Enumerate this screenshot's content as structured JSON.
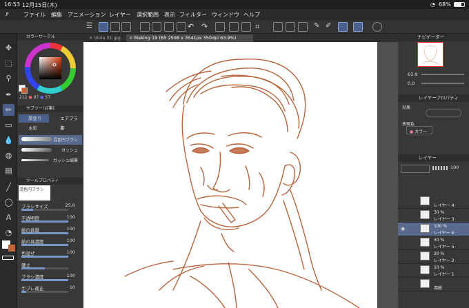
{
  "status": {
    "time": "16:53",
    "date": "12月15日(木)",
    "battery": "68%"
  },
  "menu": [
    "ファイル",
    "編集",
    "アニメーション",
    "レイヤー",
    "選択範囲",
    "表示",
    "フィルター",
    "ウィンドウ",
    "ヘルプ"
  ],
  "tabs": [
    "Viola 01.jpg",
    "Making 19 (B5 2508 x 3541px 350dpi 63.9%)"
  ],
  "color_circle": {
    "title": "カラーサークル",
    "h": "212",
    "s": "97",
    "v": "57",
    "main_color": "#c8643c"
  },
  "subtool": {
    "title": "サブツール[筆]",
    "groups": [
      "厚塗り",
      "エアブラシ",
      "水彩",
      "墨"
    ],
    "brushes": [
      "混色円ブラシ",
      "ガッシュ",
      "ガッシュ細筆"
    ]
  },
  "tool_property": {
    "title": "ツールプロパティ",
    "brush_name": "混色円ブラシ",
    "rows": [
      {
        "label": "ブラシサイズ",
        "value": "25.0",
        "fill": 0.25
      },
      {
        "label": "不透明度",
        "value": "100",
        "fill": 1.0
      },
      {
        "label": "絵の具量",
        "value": "100",
        "fill": 1.0
      },
      {
        "label": "絵の具濃度",
        "value": "100",
        "fill": 1.0
      },
      {
        "label": "色混ぜ",
        "value": "100",
        "fill": 1.0
      },
      {
        "label": "硬さ",
        "value": "",
        "fill": 0.5
      },
      {
        "label": "ブラシ濃度",
        "value": "100",
        "fill": 1.0
      },
      {
        "label": "手ブレ補正",
        "value": "10",
        "fill": 0.1
      }
    ]
  },
  "navigator": {
    "title": "ナビゲーター",
    "zoom": "63.9",
    "rotation": "0.0"
  },
  "layer_property": {
    "title": "レイヤープロパティ",
    "effect_label": "効果",
    "expression_label": "表現色",
    "expression_value": "カラー"
  },
  "layers": {
    "title": "レイヤー",
    "opacity": "100",
    "items": [
      {
        "mode": "",
        "name": "レイヤー 4"
      },
      {
        "mode": "30 %",
        "name": "レイヤー 3"
      },
      {
        "mode": "100 %",
        "name": "レイヤー 6"
      },
      {
        "mode": "30 %",
        "name": "レイヤー 5"
      },
      {
        "mode": "20 %",
        "name": "レイヤー 2"
      },
      {
        "mode": "10 %",
        "name": "レイヤー 1"
      },
      {
        "mode": "",
        "name": "用紙"
      }
    ]
  },
  "colors": {
    "accent": "#4a5f8a",
    "line_art": "#b8623a"
  }
}
